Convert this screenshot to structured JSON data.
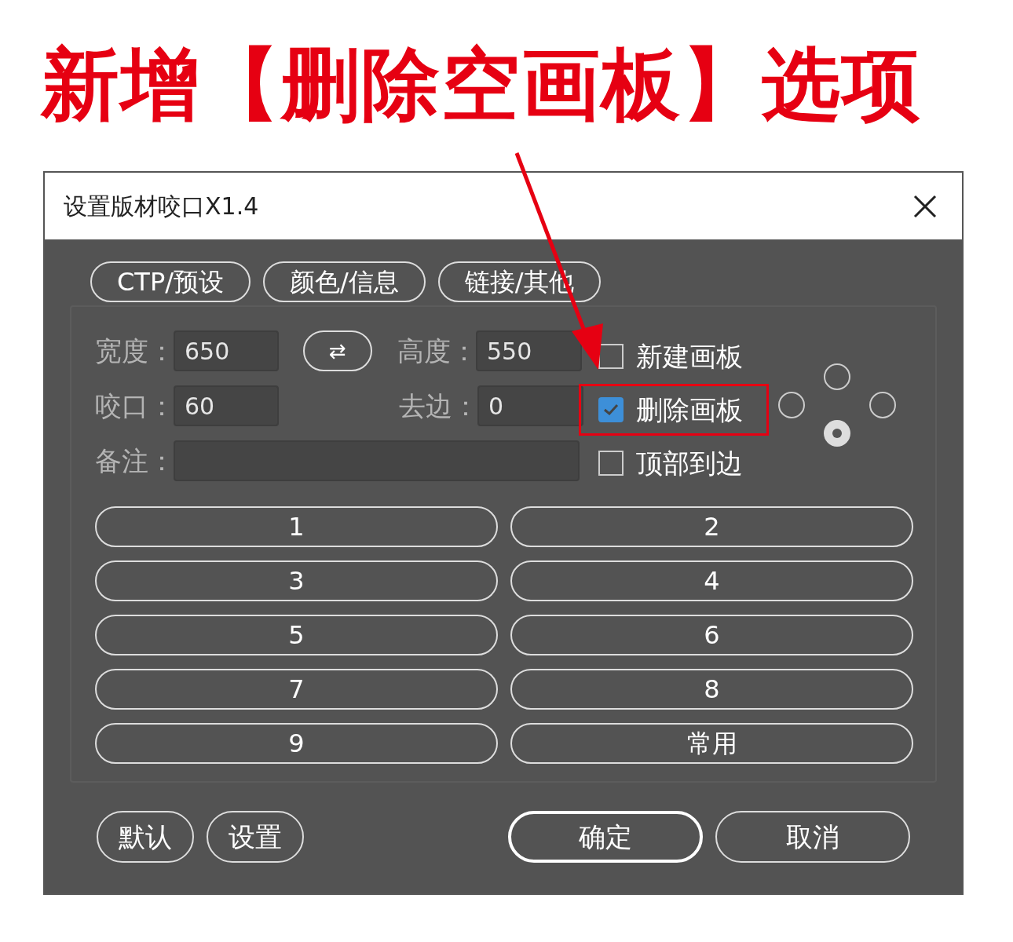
{
  "annotation": {
    "headline": "新增【删除空画板】选项"
  },
  "window": {
    "title": "设置版材咬口X1.4"
  },
  "tabs": [
    {
      "label": "CTP/预设"
    },
    {
      "label": "颜色/信息"
    },
    {
      "label": "链接/其他"
    }
  ],
  "fields": {
    "width": {
      "label": "宽度：",
      "value": "650"
    },
    "swap": "⇄",
    "height": {
      "label": "高度：",
      "value": "550"
    },
    "bleed": {
      "label": "咬口：",
      "value": "60"
    },
    "trim": {
      "label": "去边：",
      "value": "0"
    },
    "note": {
      "label": "备注："
    }
  },
  "checkboxes": [
    {
      "label": "新建画板",
      "checked": false,
      "highlighted": false
    },
    {
      "label": "删除画板",
      "checked": true,
      "highlighted": true
    },
    {
      "label": "顶部到边",
      "checked": false,
      "highlighted": false
    }
  ],
  "anchor": [
    {
      "kind": "top",
      "selected": false
    },
    {
      "kind": "left",
      "selected": false
    },
    {
      "kind": "right",
      "selected": false
    },
    {
      "kind": "bottom",
      "selected": true
    }
  ],
  "preset_buttons": [
    "1",
    "2",
    "3",
    "4",
    "5",
    "6",
    "7",
    "8",
    "9",
    "常用"
  ],
  "footer_buttons": [
    {
      "label": "默认",
      "default": false
    },
    {
      "label": "设置",
      "default": false
    },
    {
      "label": "确定",
      "default": true
    },
    {
      "label": "取消",
      "default": false
    }
  ]
}
